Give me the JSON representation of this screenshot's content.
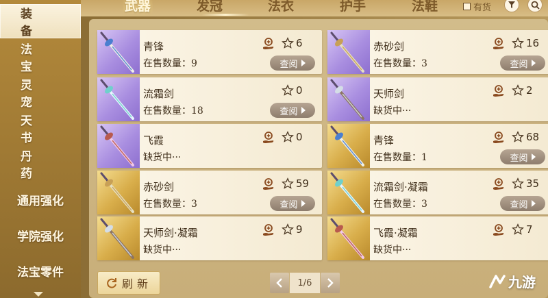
{
  "sidebar": {
    "items": [
      {
        "label": "装备",
        "active": true
      },
      {
        "label": "法宝"
      },
      {
        "label": "灵宠"
      },
      {
        "label": "天书"
      },
      {
        "label": "丹药"
      },
      {
        "label": "通用强化"
      },
      {
        "label": "学院强化"
      },
      {
        "label": "法宝零件"
      }
    ]
  },
  "tabs": [
    {
      "label": "武器",
      "active": true
    },
    {
      "label": "发冠"
    },
    {
      "label": "法衣"
    },
    {
      "label": "护手"
    },
    {
      "label": "法鞋"
    }
  ],
  "filter": {
    "in_stock_label": "有货",
    "checked": false
  },
  "items": [
    {
      "name": "青锋",
      "stock_text": "在售数量：9",
      "favorites": "6",
      "has_view": true,
      "has_hand": true,
      "bg": "purple",
      "accent": "#4a7fd0",
      "hilt": "#f0efe8"
    },
    {
      "name": "赤砂剑",
      "stock_text": "在售数量：3",
      "favorites": "16",
      "has_view": true,
      "has_hand": true,
      "bg": "purple",
      "accent": "#c8a056",
      "hilt": "#e6e0c2"
    },
    {
      "name": "流霜剑",
      "stock_text": "在售数量：18",
      "favorites": "0",
      "has_view": true,
      "has_hand": false,
      "bg": "purple",
      "accent": "#6fd0cc",
      "hilt": "#e8f4ff"
    },
    {
      "name": "天师剑",
      "stock_text": "缺货中···",
      "favorites": "2",
      "has_view": false,
      "has_hand": true,
      "bg": "purple",
      "accent": "#d4dde6",
      "hilt": "#8d7563"
    },
    {
      "name": "飞霞",
      "stock_text": "缺货中···",
      "favorites": "0",
      "has_view": false,
      "has_hand": true,
      "bg": "purple",
      "accent": "#b85a4e",
      "hilt": "#f0c8e8"
    },
    {
      "name": "青锋",
      "stock_text": "在售数量：1",
      "favorites": "68",
      "has_view": true,
      "has_hand": true,
      "bg": "gold",
      "accent": "#4a7fd0",
      "hilt": "#f0efe8"
    },
    {
      "name": "赤砂剑",
      "stock_text": "在售数量：3",
      "favorites": "59",
      "has_view": true,
      "has_hand": true,
      "bg": "gold",
      "accent": "#c8a056",
      "hilt": "#e6e0c2"
    },
    {
      "name": "流霜剑·凝霜",
      "stock_text": "在售数量：3",
      "favorites": "35",
      "has_view": true,
      "has_hand": true,
      "bg": "gold",
      "accent": "#6fd0cc",
      "hilt": "#e8f4ff"
    },
    {
      "name": "天师剑·凝霜",
      "stock_text": "缺货中···",
      "favorites": "9",
      "has_view": false,
      "has_hand": true,
      "bg": "gold",
      "accent": "#d4dde6",
      "hilt": "#8d7563"
    },
    {
      "name": "飞霞·凝霜",
      "stock_text": "缺货中···",
      "favorites": "7",
      "has_view": false,
      "has_hand": true,
      "bg": "gold",
      "accent": "#b85a4e",
      "hilt": "#f0c8e8"
    }
  ],
  "view_label": "查阅",
  "refresh_label": "刷新",
  "pagination": {
    "text": "1/6"
  },
  "watermark": {
    "text": "九游"
  }
}
